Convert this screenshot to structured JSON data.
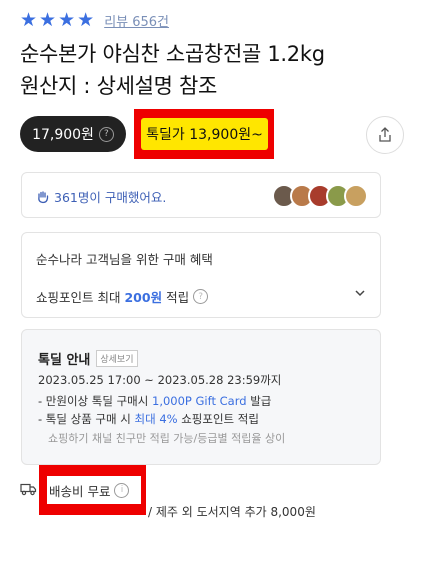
{
  "rating": {
    "stars": 4,
    "review_link": "리뷰 656건"
  },
  "title": {
    "line1": "순수본가 야심찬 소곱창전골 1.2kg",
    "line2": "원산지 : 상세설명 참조"
  },
  "price": {
    "regular": "17,900원",
    "hot_deal": "톡딜가 13,900원~"
  },
  "buyers": {
    "text": "361명이 구매했어요."
  },
  "benefits": {
    "title": "순수나라 고객님을 위한 구매 혜택",
    "line_prefix": "쇼핑포인트 최대",
    "line_amount": "200원",
    "line_suffix": "적립"
  },
  "deal": {
    "title": "톡딜 안내",
    "detail_button": "상세보기",
    "period": "2023.05.25 17:00 ~ 2023.05.28 23:59까지",
    "item1_prefix": "- 만원이상 톡딜 구매시",
    "item1_highlight": "1,000P Gift Card",
    "item1_suffix": "발급",
    "item2_prefix": "- 톡딜 상품 구매 시",
    "item2_highlight": "최대 4%",
    "item2_suffix": "쇼핑포인트 적립",
    "note": "쇼핑하기 채널 친구만 적립 가능/등급별 적립율 상이"
  },
  "shipping": {
    "label": "배송비 무료",
    "extra": "/ 제주 외 도서지역 추가 8,000원"
  },
  "colors": {
    "accent": "#3b6fe0",
    "highlight_yellow": "#ffe600",
    "box_red": "#e00000"
  }
}
